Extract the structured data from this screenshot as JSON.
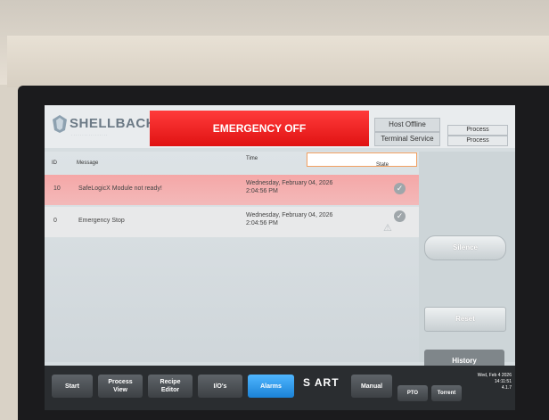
{
  "header": {
    "logo_text": "SHELLBACK",
    "emergency_label": "EMERGENCY OFF",
    "host_label": "Host Offline",
    "terminal_label": "Terminal Service",
    "process_1": "Process",
    "process_2": "Process"
  },
  "table": {
    "columns": [
      "ID",
      "Message",
      "Time",
      "State"
    ],
    "rows": [
      {
        "id": "10",
        "message": "SafeLogicX Module not ready!",
        "time_1": "Wednesday, February 04, 2026",
        "time_2": "2:04:56 PM",
        "state": "check"
      },
      {
        "id": "0",
        "message": "Emergency Stop",
        "time_1": "Wednesday, February 04, 2026",
        "time_2": "2:04:56 PM",
        "state": "check"
      }
    ]
  },
  "right_panel": {
    "silence_label": "Silence",
    "reset_label": "Reset",
    "history_label": "History"
  },
  "nav": {
    "start": "Start",
    "process_view_1": "Process",
    "process_view_2": "View",
    "recipe_1": "Recipe",
    "recipe_2": "Editor",
    "ios": "I/O's",
    "alarms": "Alarms",
    "brand": "S  ART",
    "manual": "Manual",
    "pto": "PTO",
    "torrent": "Torrent",
    "date": "Wed, Feb 4 2026",
    "time": "14:11:51",
    "version": "4.1.7"
  },
  "colors": {
    "emergency_red": "#e01212",
    "alarm_row": "#f5a7a7",
    "active_tab": "#1b82d6"
  }
}
